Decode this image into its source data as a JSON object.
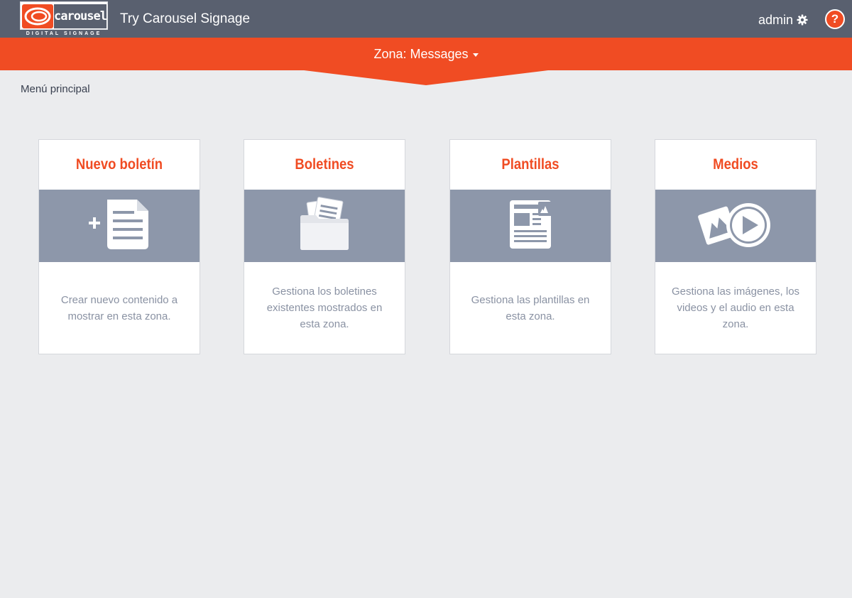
{
  "header": {
    "logo_word": "carousel",
    "logo_sub": "DIGITAL SIGNAGE",
    "app_title": "Try Carousel Signage",
    "user_name": "admin",
    "help_label": "?"
  },
  "zone": {
    "label": "Zona: Messages"
  },
  "breadcrumb": "Menú principal",
  "cards": [
    {
      "title": "Nuevo boletín",
      "icon": "new-document-icon",
      "description": "Crear nuevo contenido a mostrar en esta zona."
    },
    {
      "title": "Boletines",
      "icon": "folder-icon",
      "description": "Gestiona los boletines existentes mostrados en esta zona."
    },
    {
      "title": "Plantillas",
      "icon": "template-icon",
      "description": "Gestiona las plantillas en esta zona."
    },
    {
      "title": "Medios",
      "icon": "media-icon",
      "description": "Gestiona las imágenes, los videos y el audio en esta zona."
    }
  ],
  "colors": {
    "accent": "#f04c23",
    "header_bg": "#59606f",
    "band_bg": "#8d97aa",
    "page_bg": "#ebecee"
  }
}
